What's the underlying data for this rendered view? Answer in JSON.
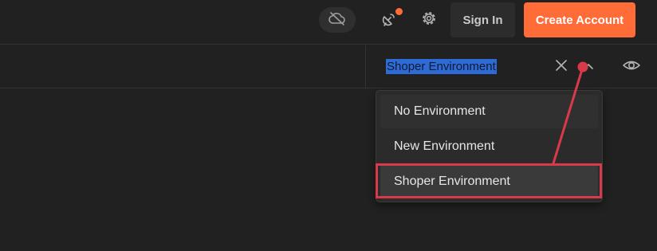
{
  "header": {
    "sign_in_label": "Sign In",
    "create_account_label": "Create Account",
    "icons": [
      "cloud-off-icon",
      "satellite-icon",
      "gear-icon"
    ]
  },
  "environment": {
    "selected": "Shoper Environment",
    "icons": [
      "close-icon",
      "chevron-up-icon",
      "eye-icon"
    ],
    "options": [
      {
        "label": "No Environment"
      },
      {
        "label": "New Environment"
      },
      {
        "label": "Shoper Environment"
      }
    ]
  },
  "colors": {
    "accent": "#ff6c37",
    "selection": "#2f6bd6",
    "annotation": "#d93a4a"
  }
}
